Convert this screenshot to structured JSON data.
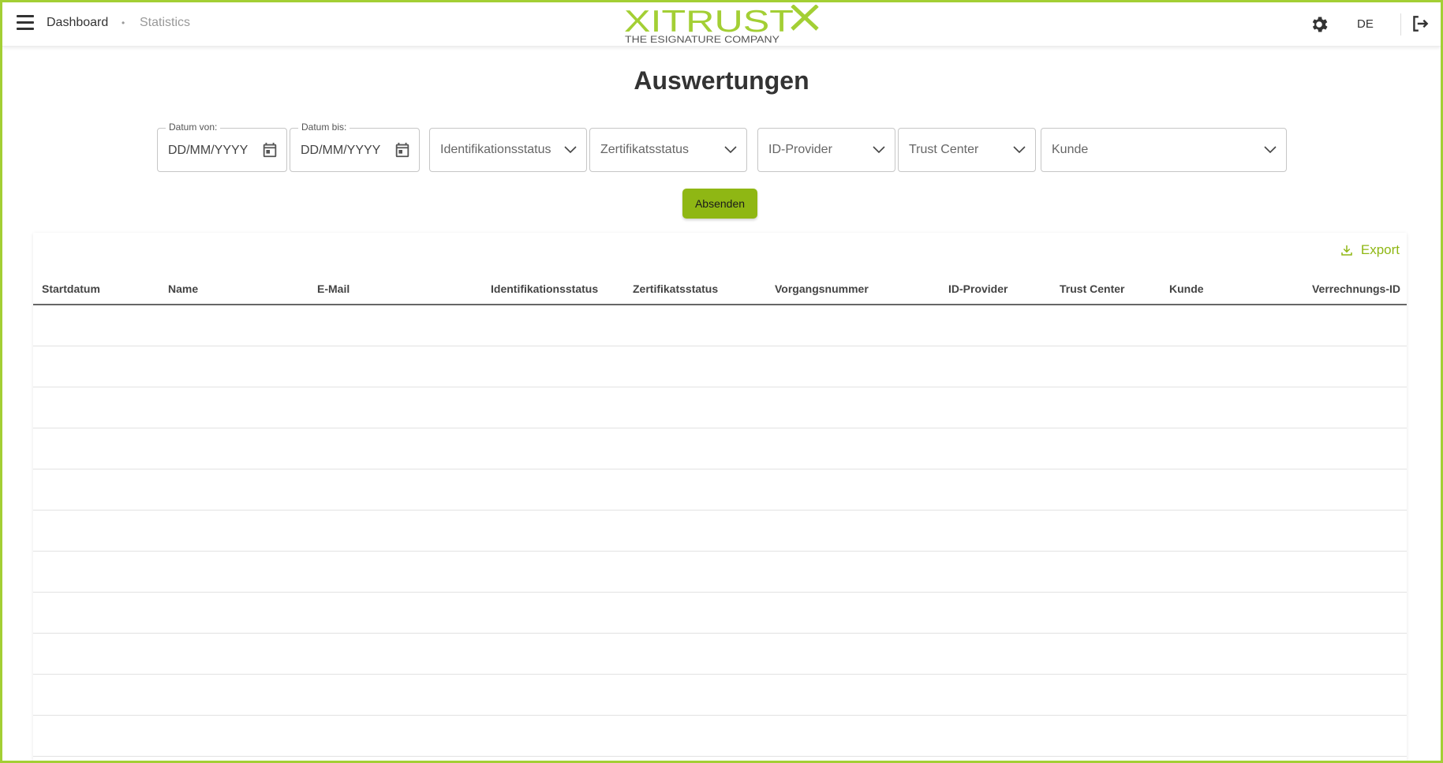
{
  "header": {
    "breadcrumb": {
      "dashboard": "Dashboard",
      "separator": "•",
      "current": "Statistics"
    },
    "logo": {
      "brand": "XITRUST",
      "tagline": "THE ESIGNATURE COMPANY",
      "color": "#a3cf34"
    },
    "language": "DE",
    "icons": [
      "menu-icon",
      "gear-icon",
      "logout-icon"
    ]
  },
  "page": {
    "title": "Auswertungen"
  },
  "filters": {
    "date_from": {
      "label": "Datum von:",
      "value": "DD/MM/YYYY"
    },
    "date_to": {
      "label": "Datum bis:",
      "value": "DD/MM/YYYY"
    },
    "identification_status": "Identifikationsstatus",
    "certificate_status": "Zertifikatsstatus",
    "id_provider": "ID-Provider",
    "trust_center": "Trust Center",
    "customer": "Kunde",
    "submit_label": "Absenden"
  },
  "table": {
    "export_label": "Export",
    "columns": [
      "Startdatum",
      "Name",
      "E-Mail",
      "Identifikationsstatus",
      "Zertifikatsstatus",
      "Vorgangsnummer",
      "ID-Provider",
      "Trust Center",
      "Kunde",
      "Verrechnungs-ID"
    ],
    "rows": []
  },
  "colors": {
    "accent": "#a3cf34",
    "button": "#8fb714",
    "text": "#333333"
  }
}
